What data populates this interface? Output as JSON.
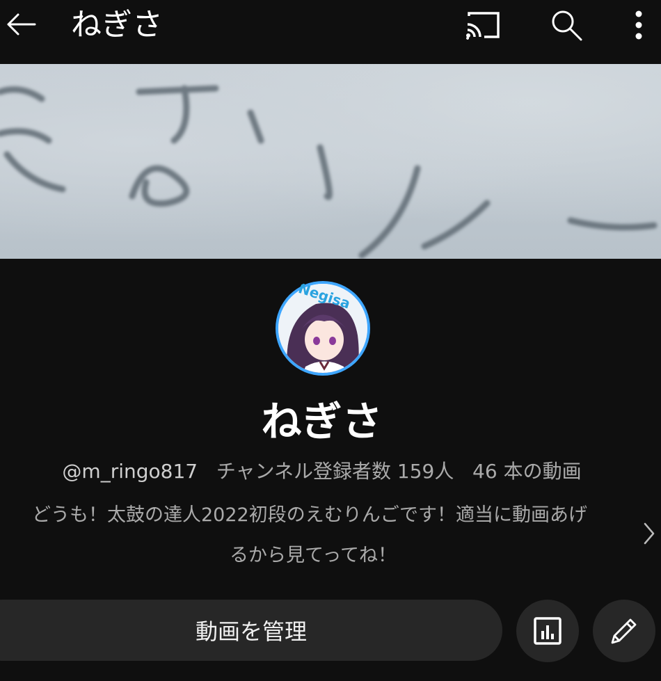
{
  "header": {
    "title": "ねぎさ",
    "icons": [
      "back-arrow-icon",
      "cast-icon",
      "search-icon",
      "more-vert-icon"
    ]
  },
  "banner": {
    "description": "Channel banner image"
  },
  "avatar": {
    "label": "Negisa"
  },
  "channel": {
    "name": "ねぎさ",
    "handle": "@m_ringo817",
    "subscribers": "チャンネル登録者数 159人",
    "videos": "46 本の動画",
    "description_line1": "どうも！太鼓の達人2022初段のえむりんごです！適当に動画あげ",
    "description_line2": "るから見てってね！"
  },
  "actions": {
    "manage_label": "動画を管理",
    "icons": [
      "analytics-icon",
      "edit-pencil-icon"
    ]
  },
  "colors": {
    "background": "#0f0f0f",
    "button_bg": "#272727",
    "text_primary": "#f1f1f1",
    "text_secondary": "#aaaaaa",
    "avatar_ring": "#3ea6ff"
  }
}
